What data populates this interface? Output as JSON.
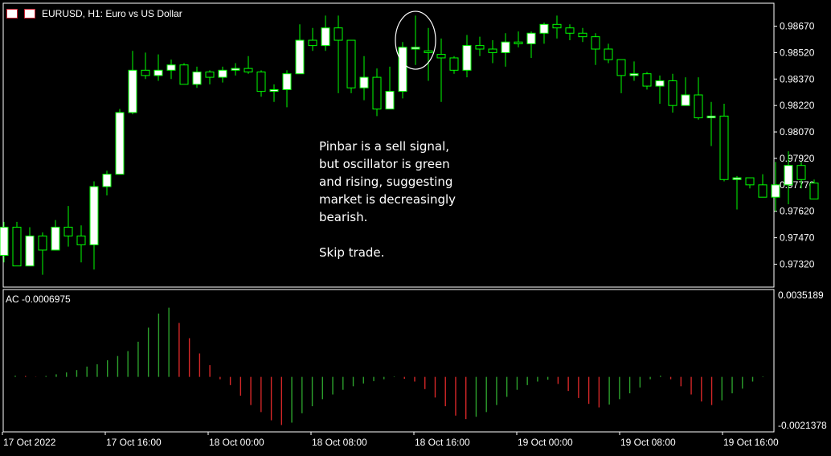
{
  "header": {
    "symbol_line": "EURUSD, H1:  Euro vs US Dollar",
    "icons": [
      "chart-menu-icon",
      "chart-symbol-icon"
    ]
  },
  "annotation": {
    "lines": [
      "Pinbar is a sell signal,",
      "but oscillator is green",
      "and rising, suggesting",
      "market is decreasingly",
      "bearish.",
      "",
      "Skip trade."
    ]
  },
  "oscillator": {
    "label": "AC -0.0006975"
  },
  "colors": {
    "background": "#000000",
    "bull_body": "#ffffff",
    "wick": "#00ff00",
    "osc_up": "#2ca02c",
    "osc_down": "#d62728",
    "frame": "#ffffff",
    "annotation_ellipse": "#ffffff"
  },
  "chart_data": [
    {
      "type": "candlestick",
      "title": "EURUSD, H1:  Euro vs US Dollar",
      "ylim": [
        0.9719,
        0.988
      ],
      "y_ticks": [
        0.9867,
        0.9852,
        0.9837,
        0.9822,
        0.9807,
        0.9792,
        0.9777,
        0.9762,
        0.9747,
        0.9732
      ],
      "y_tick_labels": [
        "0.98670",
        "0.98520",
        "0.98370",
        "0.98220",
        "0.98070",
        "0.97920",
        "0.97770",
        "0.97620",
        "0.97470",
        "0.97320"
      ],
      "x_tick_labels": [
        "17 Oct 2022",
        "17 Oct 16:00",
        "18 Oct 00:00",
        "18 Oct 08:00",
        "18 Oct 16:00",
        "19 Oct 00:00",
        "19 Oct 08:00",
        "19 Oct 16:00"
      ],
      "x_tick_index": [
        0,
        8,
        16,
        24,
        32,
        40,
        48,
        56
      ],
      "annotation": "ellipse around pinbar at candle index 31",
      "candles": [
        {
          "o": 0.9737,
          "h": 0.9756,
          "l": 0.9733,
          "c": 0.9753
        },
        {
          "o": 0.9753,
          "h": 0.9756,
          "l": 0.9731,
          "c": 0.9731
        },
        {
          "o": 0.9731,
          "h": 0.9753,
          "l": 0.9731,
          "c": 0.9748
        },
        {
          "o": 0.9748,
          "h": 0.975,
          "l": 0.9726,
          "c": 0.974
        },
        {
          "o": 0.974,
          "h": 0.9757,
          "l": 0.974,
          "c": 0.9753
        },
        {
          "o": 0.9753,
          "h": 0.9765,
          "l": 0.9742,
          "c": 0.9748
        },
        {
          "o": 0.9748,
          "h": 0.9754,
          "l": 0.9733,
          "c": 0.9743
        },
        {
          "o": 0.9743,
          "h": 0.9779,
          "l": 0.9729,
          "c": 0.9776
        },
        {
          "o": 0.9776,
          "h": 0.9785,
          "l": 0.9771,
          "c": 0.9783
        },
        {
          "o": 0.9783,
          "h": 0.982,
          "l": 0.9783,
          "c": 0.9818
        },
        {
          "o": 0.9818,
          "h": 0.9853,
          "l": 0.9817,
          "c": 0.9842
        },
        {
          "o": 0.9842,
          "h": 0.9852,
          "l": 0.9837,
          "c": 0.9839
        },
        {
          "o": 0.9839,
          "h": 0.9851,
          "l": 0.9836,
          "c": 0.9842
        },
        {
          "o": 0.9842,
          "h": 0.9848,
          "l": 0.9837,
          "c": 0.9845
        },
        {
          "o": 0.9845,
          "h": 0.9846,
          "l": 0.9834,
          "c": 0.9834
        },
        {
          "o": 0.9834,
          "h": 0.9844,
          "l": 0.9832,
          "c": 0.9841
        },
        {
          "o": 0.9841,
          "h": 0.9842,
          "l": 0.9834,
          "c": 0.9838
        },
        {
          "o": 0.9838,
          "h": 0.9844,
          "l": 0.9835,
          "c": 0.9842
        },
        {
          "o": 0.9842,
          "h": 0.9846,
          "l": 0.9839,
          "c": 0.9843
        },
        {
          "o": 0.9843,
          "h": 0.985,
          "l": 0.984,
          "c": 0.9841
        },
        {
          "o": 0.9841,
          "h": 0.9842,
          "l": 0.9827,
          "c": 0.983
        },
        {
          "o": 0.983,
          "h": 0.9834,
          "l": 0.9824,
          "c": 0.9831
        },
        {
          "o": 0.9831,
          "h": 0.9842,
          "l": 0.9821,
          "c": 0.984
        },
        {
          "o": 0.984,
          "h": 0.9868,
          "l": 0.984,
          "c": 0.9859
        },
        {
          "o": 0.9859,
          "h": 0.9866,
          "l": 0.9853,
          "c": 0.9856
        },
        {
          "o": 0.9856,
          "h": 0.9873,
          "l": 0.9853,
          "c": 0.9866
        },
        {
          "o": 0.9866,
          "h": 0.9873,
          "l": 0.9829,
          "c": 0.9859
        },
        {
          "o": 0.9859,
          "h": 0.9859,
          "l": 0.9829,
          "c": 0.9832
        },
        {
          "o": 0.9832,
          "h": 0.985,
          "l": 0.9825,
          "c": 0.9838
        },
        {
          "o": 0.9838,
          "h": 0.9843,
          "l": 0.9816,
          "c": 0.982
        },
        {
          "o": 0.982,
          "h": 0.9844,
          "l": 0.982,
          "c": 0.983
        },
        {
          "o": 0.983,
          "h": 0.9858,
          "l": 0.9826,
          "c": 0.9855
        },
        {
          "o": 0.9854,
          "h": 0.9873,
          "l": 0.9845,
          "c": 0.9855
        },
        {
          "o": 0.9853,
          "h": 0.9866,
          "l": 0.9836,
          "c": 0.9852
        },
        {
          "o": 0.9851,
          "h": 0.986,
          "l": 0.9824,
          "c": 0.9849
        },
        {
          "o": 0.9849,
          "h": 0.985,
          "l": 0.984,
          "c": 0.9842
        },
        {
          "o": 0.9842,
          "h": 0.9862,
          "l": 0.9838,
          "c": 0.9856
        },
        {
          "o": 0.9856,
          "h": 0.9861,
          "l": 0.985,
          "c": 0.9854
        },
        {
          "o": 0.9854,
          "h": 0.9859,
          "l": 0.9846,
          "c": 0.9852
        },
        {
          "o": 0.9852,
          "h": 0.9863,
          "l": 0.9844,
          "c": 0.9858
        },
        {
          "o": 0.9858,
          "h": 0.9864,
          "l": 0.9855,
          "c": 0.9857
        },
        {
          "o": 0.9857,
          "h": 0.9864,
          "l": 0.9849,
          "c": 0.9863
        },
        {
          "o": 0.9863,
          "h": 0.9869,
          "l": 0.9857,
          "c": 0.9868
        },
        {
          "o": 0.9868,
          "h": 0.9873,
          "l": 0.986,
          "c": 0.9866
        },
        {
          "o": 0.9866,
          "h": 0.9868,
          "l": 0.9859,
          "c": 0.9863
        },
        {
          "o": 0.9863,
          "h": 0.9866,
          "l": 0.9858,
          "c": 0.9861
        },
        {
          "o": 0.9861,
          "h": 0.9863,
          "l": 0.9845,
          "c": 0.9854
        },
        {
          "o": 0.9854,
          "h": 0.9857,
          "l": 0.9846,
          "c": 0.9848
        },
        {
          "o": 0.9848,
          "h": 0.9844,
          "l": 0.9829,
          "c": 0.9839
        },
        {
          "o": 0.9839,
          "h": 0.9847,
          "l": 0.9836,
          "c": 0.984
        },
        {
          "o": 0.984,
          "h": 0.9841,
          "l": 0.9831,
          "c": 0.9833
        },
        {
          "o": 0.9833,
          "h": 0.9839,
          "l": 0.9823,
          "c": 0.9836
        },
        {
          "o": 0.9836,
          "h": 0.984,
          "l": 0.9818,
          "c": 0.9822
        },
        {
          "o": 0.9822,
          "h": 0.9838,
          "l": 0.9822,
          "c": 0.9828
        },
        {
          "o": 0.9828,
          "h": 0.9838,
          "l": 0.9814,
          "c": 0.9815
        },
        {
          "o": 0.9815,
          "h": 0.9824,
          "l": 0.9799,
          "c": 0.9816
        },
        {
          "o": 0.9816,
          "h": 0.9823,
          "l": 0.9779,
          "c": 0.978
        },
        {
          "o": 0.978,
          "h": 0.9782,
          "l": 0.9763,
          "c": 0.9781
        },
        {
          "o": 0.9781,
          "h": 0.9781,
          "l": 0.9775,
          "c": 0.9777
        },
        {
          "o": 0.9777,
          "h": 0.9783,
          "l": 0.977,
          "c": 0.977
        },
        {
          "o": 0.977,
          "h": 0.979,
          "l": 0.9762,
          "c": 0.9777
        },
        {
          "o": 0.9777,
          "h": 0.9796,
          "l": 0.9766,
          "c": 0.9788
        },
        {
          "o": 0.9788,
          "h": 0.979,
          "l": 0.9775,
          "c": 0.978
        },
        {
          "o": 0.9778,
          "h": 0.978,
          "l": 0.9769,
          "c": 0.9769
        }
      ]
    },
    {
      "type": "bar",
      "title": "AC -0.0006975",
      "ylim": [
        -0.0021378,
        0.0035189
      ],
      "y_tick_labels": [
        "0.0035189",
        "-0.0021378"
      ],
      "values": [
        5e-05,
        4e-05,
        -1e-05,
        4e-05,
        0.00011,
        0.00019,
        0.00029,
        0.00044,
        0.00054,
        0.00071,
        0.00089,
        0.0011,
        0.0015,
        0.0021,
        0.0027,
        0.00295,
        0.0023,
        0.00165,
        0.001,
        0.0005,
        -0.0001,
        -0.00035,
        -0.0008,
        -0.0012,
        -0.0015,
        -0.00185,
        -0.00205,
        -0.00195,
        -0.00155,
        -0.00125,
        -0.00095,
        -0.00075,
        -0.00055,
        -0.0004,
        -0.00028,
        -0.00018,
        -0.0001,
        2e-05,
        -8e-05,
        -0.0002,
        -0.00052,
        -0.00088,
        -0.00125,
        -0.00165,
        -0.0018,
        -0.0017,
        -0.0015,
        -0.0012,
        -0.00085,
        -0.00055,
        -0.00035,
        -0.0002,
        -0.00012,
        -0.0003,
        -0.0006,
        -0.0009,
        -0.00115,
        -0.0013,
        -0.00118,
        -0.00095,
        -0.0007,
        -0.00045,
        -0.0001,
        5e-05,
        -0.0001,
        -0.0004,
        -0.00075,
        -0.00105,
        -0.0012,
        -0.001,
        -0.0007,
        -0.0005,
        -0.0002,
        2e-05
      ]
    }
  ]
}
